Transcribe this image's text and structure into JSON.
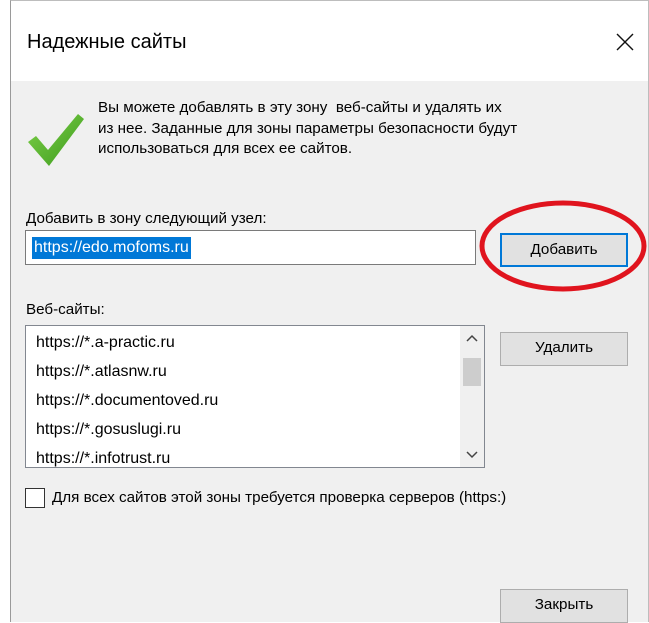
{
  "dialog": {
    "title": "Надежные сайты",
    "info_line1": "Вы можете добавлять в эту зону  веб-сайты и удалять их",
    "info_line2": "из нее. Заданные для зоны параметры безопасности будут",
    "info_line3": "использоваться для всех ее сайтов.",
    "add_label": "Добавить в зону следующий узел:",
    "url_value": "https://edo.mofoms.ru",
    "add_button_label": "Добавить",
    "sites_label": "Веб-сайты:",
    "sites": [
      "https://*.a-practic.ru",
      "https://*.atlasnw.ru",
      "https://*.documentoved.ru",
      "https://*.gosuslugi.ru",
      "https://*.infotrust.ru"
    ],
    "remove_button_label": "Удалить",
    "https_checkbox_label": "Для всех сайтов этой зоны требуется проверка серверов (https:)",
    "https_checkbox_checked": false,
    "close_button_label": "Закрыть"
  },
  "colors": {
    "accent": "#0078d7",
    "highlight_circle": "#e0141e",
    "checkmark": "#5cb82b"
  },
  "icons": {
    "check": "checkmark-icon",
    "close": "close-icon",
    "scroll_up": "chevron-up-icon",
    "scroll_down": "chevron-down-icon"
  }
}
